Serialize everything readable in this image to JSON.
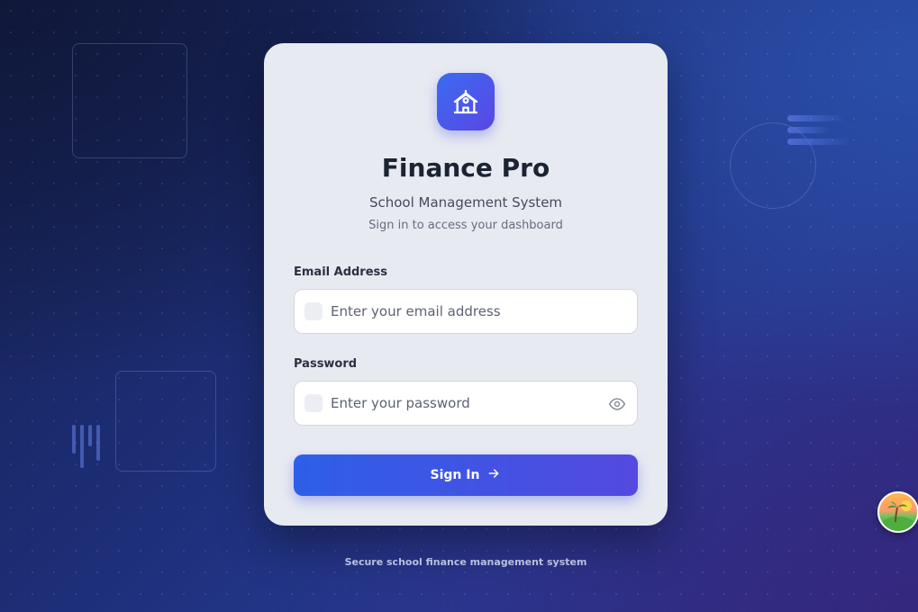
{
  "app": {
    "title": "Finance Pro",
    "subtitle": "School Management System",
    "tagline": "Sign in to access your dashboard",
    "logo_icon": "school-icon"
  },
  "form": {
    "email": {
      "label": "Email Address",
      "placeholder": "Enter your email address",
      "value": "",
      "icon": "mail-icon"
    },
    "password": {
      "label": "Password",
      "placeholder": "Enter your password",
      "value": "",
      "icon": "lock-icon",
      "toggle_icon": "eye-icon"
    },
    "submit": {
      "label": "Sign In",
      "icon": "arrow-right-icon"
    }
  },
  "footer": {
    "text": "Secure school finance management system"
  },
  "colors": {
    "accent_start": "#2d5fe8",
    "accent_end": "#5449e0",
    "card_background": "#e8eaf2",
    "page_background": "#1e2f7a"
  }
}
